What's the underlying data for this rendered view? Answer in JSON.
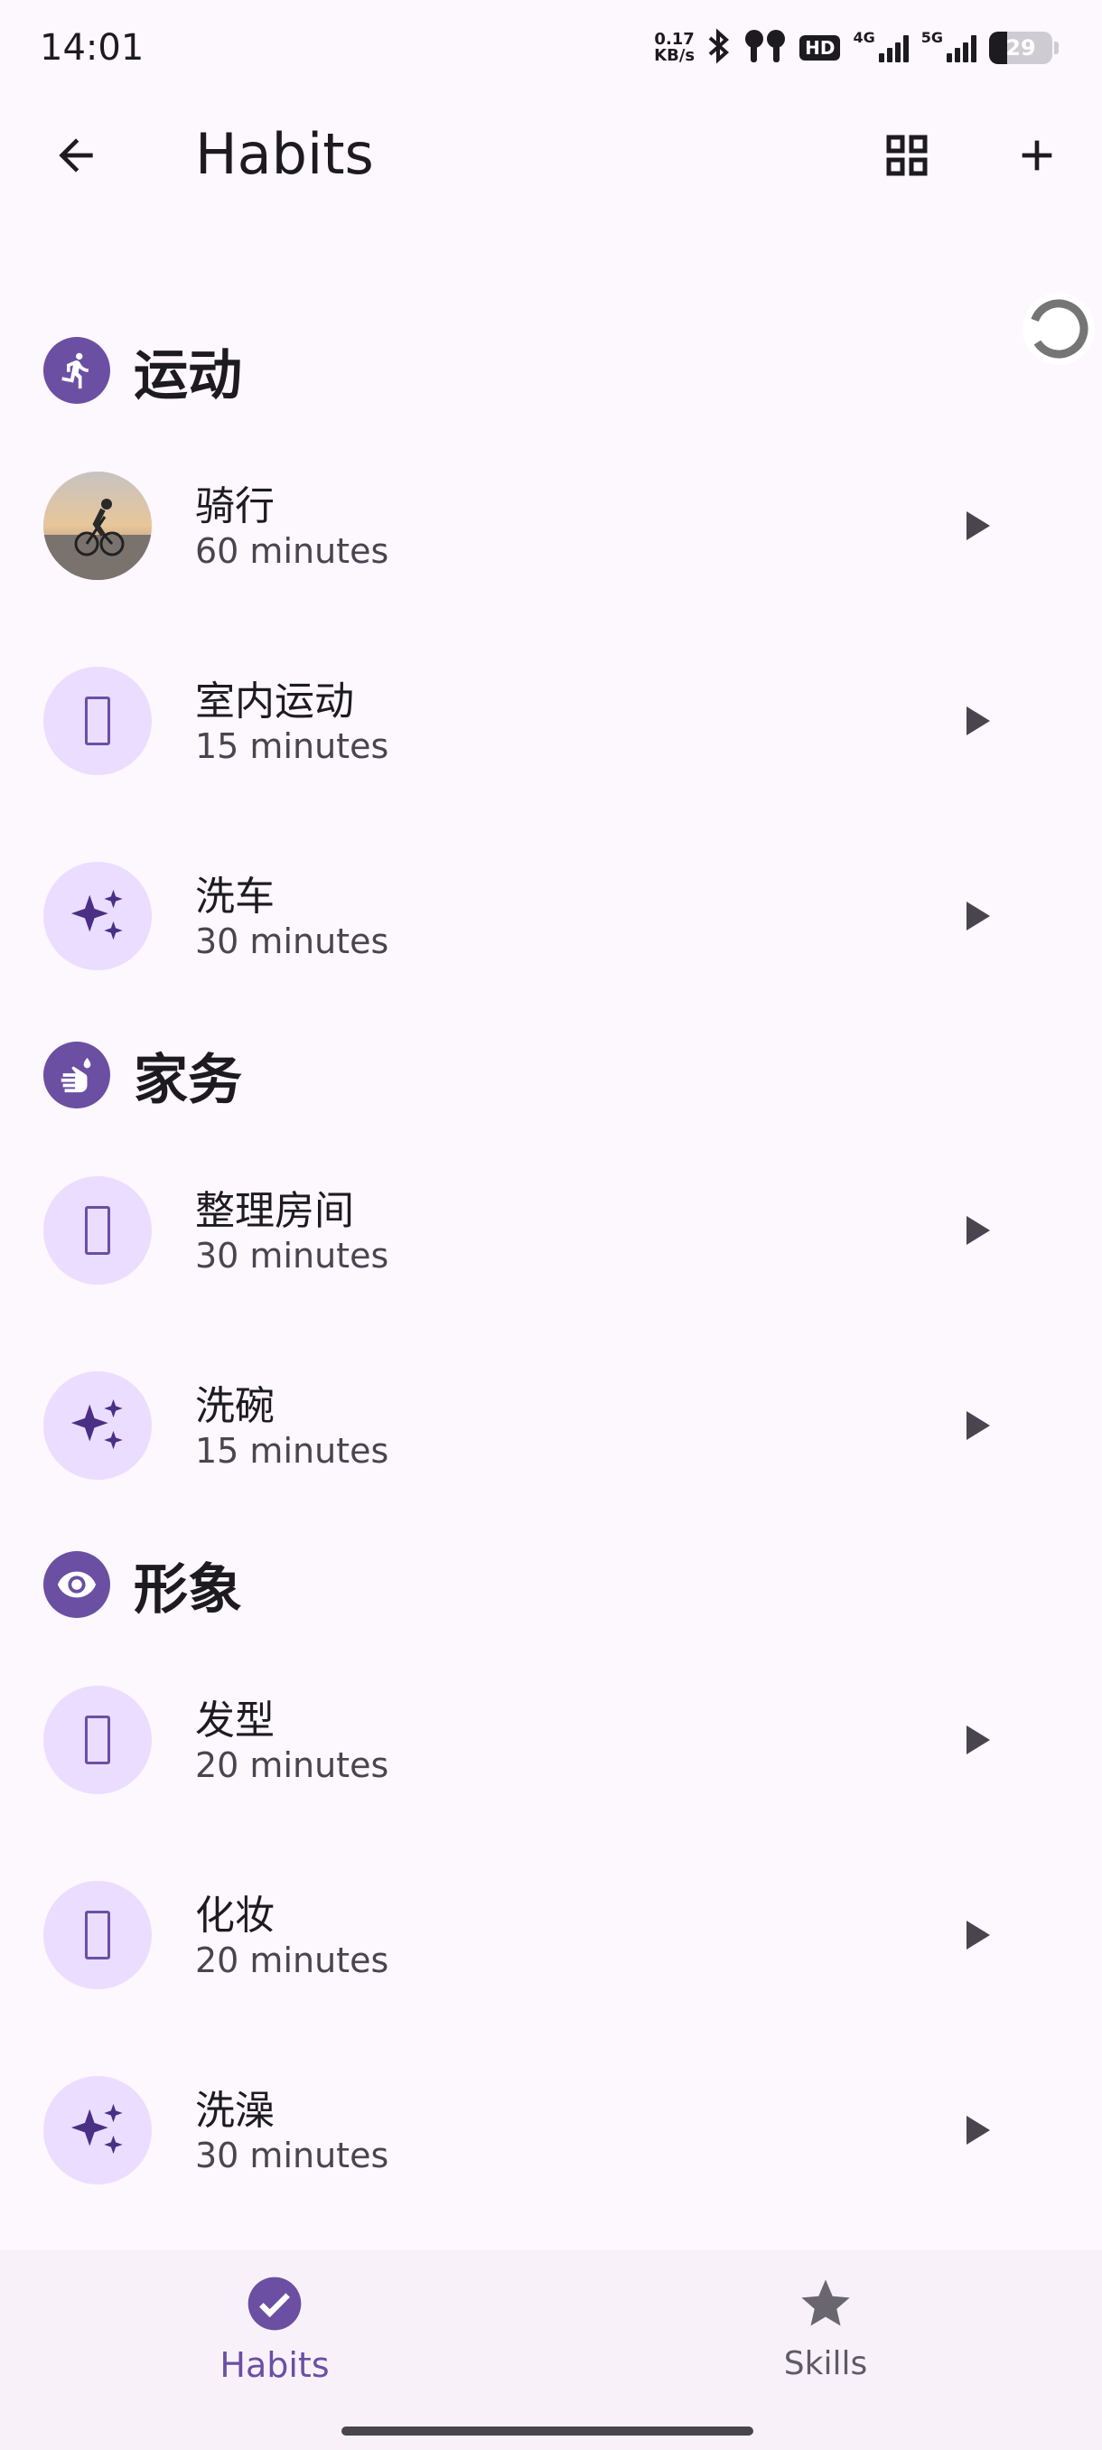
{
  "status_bar": {
    "time": "14:01",
    "net_speed_value": "0.17",
    "net_speed_unit": "KB/s",
    "hd_label": "HD",
    "signal_1_label": "4G",
    "signal_2_label": "5G",
    "battery_level": "29"
  },
  "app_bar": {
    "title": "Habits",
    "back_icon": "arrow-back-icon",
    "grid_icon": "grid-view-icon",
    "add_icon": "add-icon"
  },
  "sections": [
    {
      "title": "运动",
      "icon": "running-icon",
      "habits": [
        {
          "name": "骑行",
          "duration": "60 minutes",
          "icon": "cycling-photo"
        },
        {
          "name": "室内运动",
          "duration": "15 minutes",
          "icon": "missing-glyph"
        },
        {
          "name": "洗车",
          "duration": "30 minutes",
          "icon": "sparkle-icon"
        }
      ]
    },
    {
      "title": "家务",
      "icon": "hand-wash-icon",
      "habits": [
        {
          "name": "整理房间",
          "duration": "30 minutes",
          "icon": "missing-glyph"
        },
        {
          "name": "洗碗",
          "duration": "15 minutes",
          "icon": "sparkle-icon"
        }
      ]
    },
    {
      "title": "形象",
      "icon": "eye-icon",
      "habits": [
        {
          "name": "发型",
          "duration": "20 minutes",
          "icon": "missing-glyph"
        },
        {
          "name": "化妆",
          "duration": "20 minutes",
          "icon": "missing-glyph"
        },
        {
          "name": "洗澡",
          "duration": "30 minutes",
          "icon": "sparkle-icon"
        }
      ]
    }
  ],
  "bottom_nav": {
    "items": [
      {
        "label": "Habits",
        "icon": "check-circle-icon",
        "active": true
      },
      {
        "label": "Skills",
        "icon": "star-icon",
        "active": false
      }
    ]
  },
  "colors": {
    "accent": "#6b4fa3",
    "avatar_bg": "#eaddff",
    "background": "#fdf7fe"
  }
}
